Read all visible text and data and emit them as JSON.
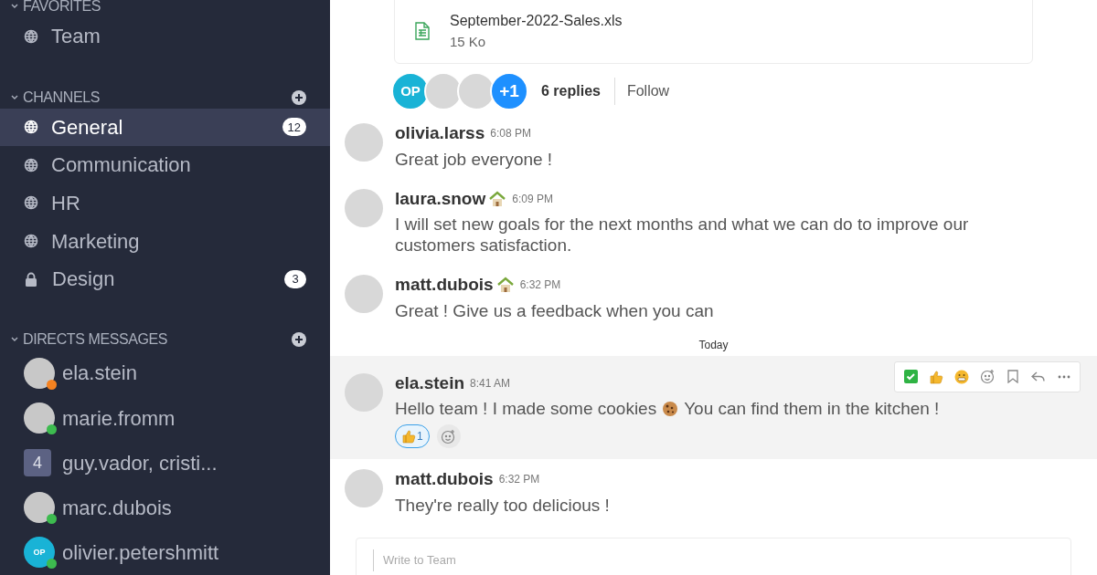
{
  "sidebar": {
    "sections": [
      {
        "title": "FAVORITES",
        "add": false,
        "items": [
          {
            "kind": "channel",
            "label": "Team",
            "selected": false
          }
        ]
      },
      {
        "title": "CHANNELS",
        "add": true,
        "items": [
          {
            "kind": "channel",
            "label": "General",
            "badge": "12",
            "selected": true
          },
          {
            "kind": "channel",
            "label": "Communication",
            "selected": false
          },
          {
            "kind": "channel",
            "label": "HR",
            "selected": false
          },
          {
            "kind": "channel",
            "label": "Marketing",
            "selected": false
          },
          {
            "kind": "private",
            "label": "Design",
            "badge": "3",
            "selected": false
          }
        ]
      },
      {
        "title": "DIRECTS MESSAGES",
        "add": true,
        "items": [
          {
            "kind": "user",
            "label": "ela.stein",
            "color": "#f58220",
            "selected": false
          },
          {
            "kind": "user",
            "label": "marie.fromm",
            "color": "#3dbb4f",
            "selected": false
          },
          {
            "kind": "group",
            "label": "guy.vador, cristi...",
            "count": "4",
            "selected": false
          },
          {
            "kind": "user",
            "label": "marc.dubois",
            "color": "#3dbb4f",
            "selected": false
          },
          {
            "kind": "initials",
            "label": "olivier.petershmitt",
            "initials": "OP",
            "color": "#3dbb4f",
            "selected": false
          }
        ]
      }
    ]
  },
  "feed": {
    "file": {
      "name": "September-2022-Sales.xls",
      "size": "15 Ko"
    },
    "thread": {
      "avatars": [
        {
          "kind": "initials",
          "text": "OP"
        },
        {
          "kind": "photo"
        },
        {
          "kind": "photo"
        },
        {
          "kind": "more",
          "text": "+1"
        }
      ],
      "replies": "6 replies",
      "follow": "Follow"
    },
    "messages": [
      {
        "kind": "message",
        "author": "olivia.larss",
        "time": "6:08 PM",
        "status_icon": false,
        "text": "Great job everyone !"
      },
      {
        "kind": "message",
        "author": "laura.snow",
        "time": "6:09 PM",
        "status_icon": true,
        "text": "I will set new goals for the next months and what we can do to improve our customers satisfaction."
      },
      {
        "kind": "message",
        "author": "matt.dubois",
        "time": "6:32 PM",
        "status_icon": true,
        "text": "Great ! Give us a feedback when you can"
      },
      {
        "kind": "divider",
        "text": "Today"
      },
      {
        "kind": "message",
        "author": "ela.stein",
        "time": "8:41 AM",
        "status_icon": false,
        "hovered": true,
        "text": "Hello team ! I made some cookies",
        "text_after": "You can find them in the kitchen !",
        "reactions": [
          {
            "count": "1",
            "selected": true
          }
        ]
      },
      {
        "kind": "message",
        "author": "matt.dubois",
        "time": "6:32 PM",
        "status_icon": false,
        "text": "They're really too delicious !"
      }
    ],
    "composer": {
      "placeholder": "Write to Team"
    }
  }
}
